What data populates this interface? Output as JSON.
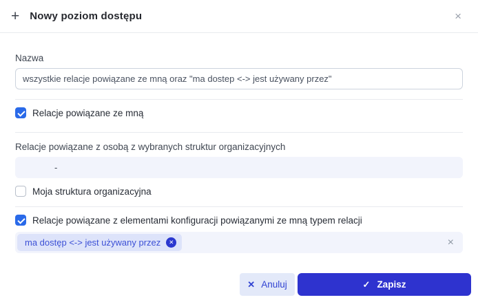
{
  "header": {
    "title": "Nowy poziom dostępu"
  },
  "icons": {
    "plus": "+",
    "close": "×",
    "cancel_x": "✕",
    "save_check": "✓",
    "chip_remove": "✕",
    "clear": "×"
  },
  "form": {
    "name": {
      "label": "Nazwa",
      "value": "wszystkie relacje powiązane ze mną oraz \"ma dostep <-> jest używany przez\""
    },
    "relations_with_me": {
      "label": "Relacje powiązane ze mną",
      "checked": true
    },
    "org_structures": {
      "label": "Relacje powiązane z osobą z wybranych struktur organizacyjnych",
      "value": "-"
    },
    "my_structure": {
      "label": "Moja struktura organizacyjna",
      "checked": false
    },
    "relation_type": {
      "label": "Relacje powiązane z elementami konfiguracji powiązanymi ze mną typem relacji",
      "checked": true,
      "chip": "ma dostęp <-> jest używany przez"
    }
  },
  "footer": {
    "cancel": "Anuluj",
    "save": "Zapisz"
  },
  "colors": {
    "checkbox_blue": "#2a6ae9",
    "save_bg": "#2e33cf",
    "cancel_bg": "#e3e9f9",
    "cancel_text": "#3143d2",
    "chip_bg": "#dde3fa",
    "chip_text": "#3c50d6",
    "chip_remove_bg": "#2b38cf",
    "field_bg": "#f2f4fc",
    "divider": "#e8eaee",
    "input_border": "#ccd3dd"
  }
}
